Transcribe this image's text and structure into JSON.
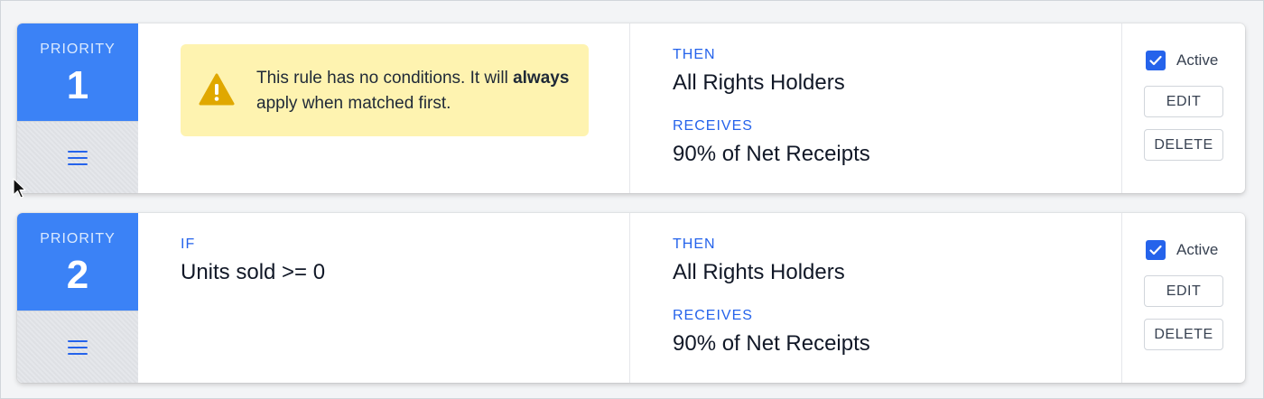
{
  "rules": [
    {
      "priority_label": "PRIORITY",
      "priority_number": "1",
      "warning": {
        "text_before": "This rule has no conditions. It will ",
        "text_bold": "always",
        "text_after": " apply when matched first."
      },
      "then_label": "THEN",
      "then_value": "All Rights Holders",
      "receives_label": "RECEIVES",
      "receives_value": "90% of Net Receipts",
      "active_label": "Active",
      "active_checked": true,
      "edit_label": "EDIT",
      "delete_label": "DELETE"
    },
    {
      "priority_label": "PRIORITY",
      "priority_number": "2",
      "if_label": "IF",
      "if_value": "Units sold >= 0",
      "then_label": "THEN",
      "then_value": "All Rights Holders",
      "receives_label": "RECEIVES",
      "receives_value": "90% of Net Receipts",
      "active_label": "Active",
      "active_checked": true,
      "edit_label": "EDIT",
      "delete_label": "DELETE"
    }
  ],
  "colors": {
    "accent": "#3b82f6",
    "label_blue": "#2563eb",
    "warning_bg": "#fef3b0",
    "warning_icon": "#e0a800"
  }
}
